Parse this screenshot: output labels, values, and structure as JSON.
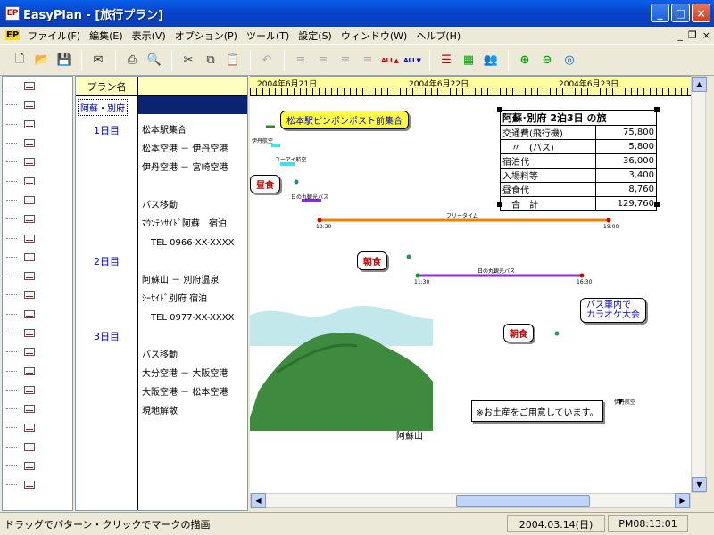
{
  "window": {
    "app_icon": "EP",
    "title": "EasyPlan - [旅行プラン]"
  },
  "menu": {
    "ep_label": "EP",
    "items": [
      "ファイル(F)",
      "編集(E)",
      "表示(V)",
      "オプション(P)",
      "ツール(T)",
      "設定(S)",
      "ウィンドウ(W)",
      "ヘルプ(H)"
    ],
    "mdi_min": "_",
    "mdi_restore": "❐",
    "mdi_close": "×"
  },
  "toolbar": {
    "icons": [
      "new-file-icon",
      "open-folder-icon",
      "save-icon",
      "mail-icon",
      "print-icon",
      "print-preview-icon",
      "cut-icon",
      "copy-icon",
      "paste-icon",
      "undo-icon",
      "align-left-icon",
      "align-center-icon",
      "align-right-icon",
      "align-justify-icon",
      "all-up-icon",
      "all-down-icon",
      "bars-icon",
      "group-icon",
      "people-icon",
      "zoom-in-icon",
      "zoom-out-icon",
      "zoom-fit-icon"
    ],
    "all_up": "ALL▲",
    "all_down": "ALL▼"
  },
  "plan_table": {
    "header_name": "プラン名",
    "plan_name": "阿蘇・別府",
    "days": [
      "1日目",
      "2日目",
      "3日目"
    ],
    "lines": [
      "松本駅集合",
      "松本空港 － 伊丹空港",
      "伊丹空港 － 宮崎空港",
      "",
      "バス移動",
      "ﾏｳﾝﾃﾝｻｲﾄﾞ阿蘇　宿泊",
      "　TEL 0966-XX-XXXX",
      "",
      "阿蘇山 － 別府温泉",
      "ｼｰｻｲﾄﾞ別府 宿泊",
      "　TEL 0977-XX-XXXX",
      "",
      "バス移動",
      "大分空港 － 大阪空港",
      "大阪空港 － 松本空港",
      "現地解散"
    ]
  },
  "timeline": {
    "dates": [
      "2004年6月21日",
      "2004年6月22日",
      "2004年6月23日"
    ],
    "callouts": {
      "meet": "松本駅ピンポンポスト前集合",
      "lunch": "昼食",
      "breakfast1": "朝食",
      "breakfast2": "朝食",
      "karaoke": "バス車内で\nカラオケ大会"
    },
    "bar_labels": {
      "flight1": "伊丹航空",
      "flight2": "ユーアイ航空",
      "bus1": "日の丸観光バス",
      "free": "フリータイム",
      "bus2": "日の丸観光バス",
      "flight3": "伊丹航空"
    },
    "bar_times": [
      "10:30",
      "19:00",
      "11:30",
      "16:30"
    ],
    "mountain_label": "阿蘇山",
    "note": "※お土産をご用意しています。",
    "cost_table": {
      "title": "阿蘇･別府 2泊3日 の旅",
      "rows": [
        {
          "item": "交通費(飛行機)",
          "value": "75,800"
        },
        {
          "item": "　〃　(バス)",
          "value": "5,800"
        },
        {
          "item": "宿泊代",
          "value": "36,000"
        },
        {
          "item": "入場料等",
          "value": "3,400"
        },
        {
          "item": "昼食代",
          "value": "8,760"
        },
        {
          "item": "　合　計",
          "value": "129,760"
        }
      ]
    },
    "colors": {
      "orange": "#f08000",
      "purple": "#8a2be2",
      "cyan": "#40e0f0",
      "green": "#2a8a2a"
    }
  },
  "status": {
    "hint": "ドラッグでパターン・クリックでマークの描画",
    "date": "2004.03.14(日)",
    "time": "PM08:13:01"
  }
}
